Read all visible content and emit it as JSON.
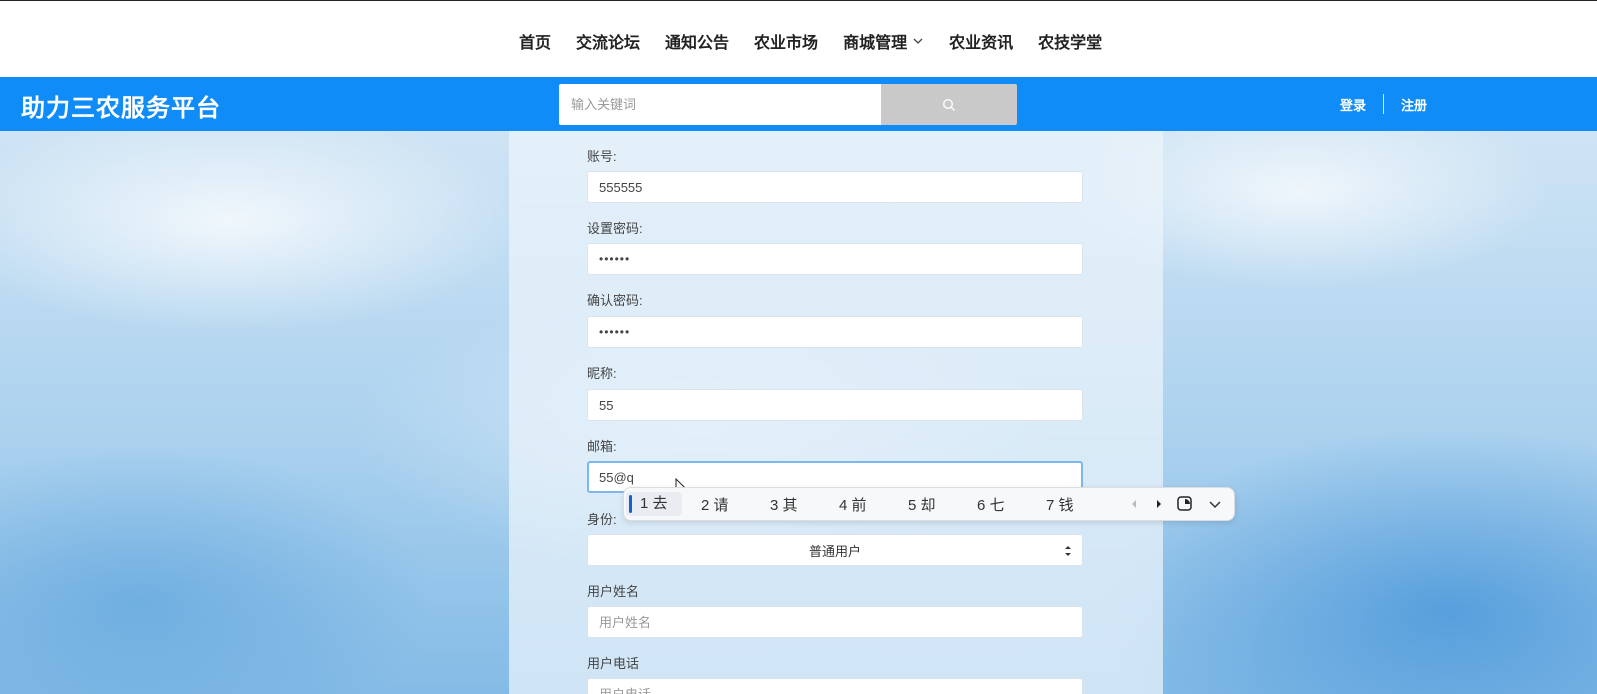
{
  "nav": {
    "items": [
      "首页",
      "交流论坛",
      "通知公告",
      "农业市场",
      "商城管理",
      "农业资讯",
      "农技学堂"
    ]
  },
  "header": {
    "brand": "助力三农服务平台",
    "search_placeholder": "输入关键词",
    "login": "登录",
    "register": "注册",
    "brand_color": "#0f8cf7"
  },
  "form": {
    "account_label": "账号:",
    "account_value": "555555",
    "password_label": "设置密码:",
    "password_value": "••••••",
    "confirm_label": "确认密码:",
    "confirm_value": "••••••",
    "nickname_label": "昵称:",
    "nickname_value": "55",
    "email_label": "邮箱:",
    "email_value": "55@q",
    "identity_label": "身份:",
    "identity_value": "普通用户",
    "realname_label": "用户姓名",
    "realname_placeholder": "用户姓名",
    "phone_label": "用户电话",
    "phone_placeholder": "用户电话"
  },
  "ime": {
    "candidates": [
      "1 去",
      "2 请",
      "3 其",
      "4 前",
      "5 却",
      "6 七",
      "7 钱"
    ]
  }
}
